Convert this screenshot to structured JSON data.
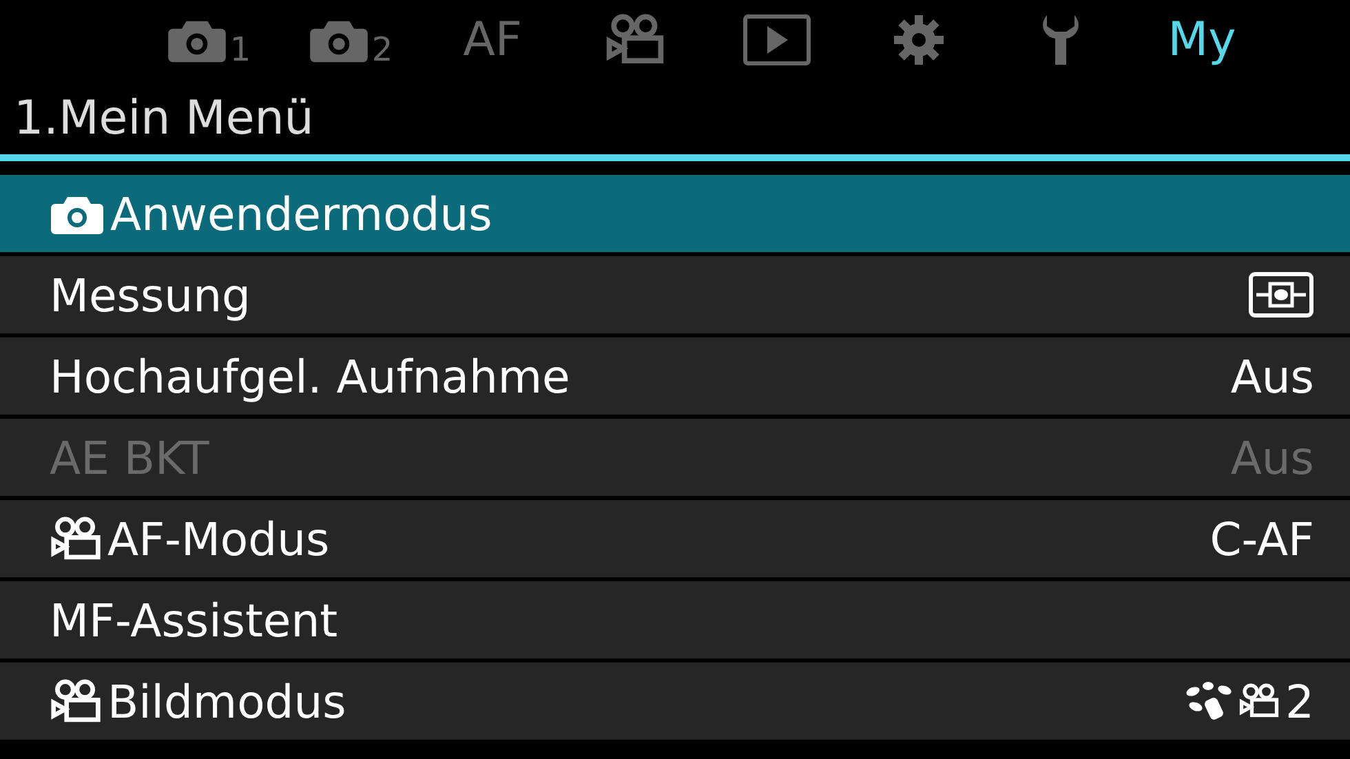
{
  "tabs": [
    {
      "kind": "camera",
      "sub": "1",
      "selected": false
    },
    {
      "kind": "camera",
      "sub": "2",
      "selected": false
    },
    {
      "kind": "text",
      "label": "AF",
      "selected": false
    },
    {
      "kind": "movie",
      "selected": false
    },
    {
      "kind": "play",
      "selected": false
    },
    {
      "kind": "gear",
      "selected": false
    },
    {
      "kind": "wrench",
      "selected": false
    },
    {
      "kind": "text",
      "label": "My",
      "selected": true
    }
  ],
  "title": "1.Mein Menü",
  "rows": [
    {
      "kind": "photo",
      "label": "Anwendermodus",
      "selected": true,
      "disabled": false
    },
    {
      "kind": "plain",
      "label": "Messung",
      "value": {
        "kind": "metering"
      },
      "selected": false,
      "disabled": false
    },
    {
      "kind": "plain",
      "label": "Hochaufgel. Aufnahme",
      "value": {
        "kind": "text",
        "text": "Aus"
      },
      "selected": false,
      "disabled": false
    },
    {
      "kind": "plain",
      "label": "AE BKT",
      "value": {
        "kind": "text",
        "text": "Aus"
      },
      "selected": false,
      "disabled": true
    },
    {
      "kind": "movie",
      "label": "AF-Modus",
      "value": {
        "kind": "text",
        "text": "C-AF"
      },
      "selected": false,
      "disabled": false
    },
    {
      "kind": "plain",
      "label": "MF-Assistent",
      "selected": false,
      "disabled": false
    },
    {
      "kind": "movie",
      "label": "Bildmodus",
      "value": {
        "kind": "picture-mode",
        "text": "2"
      },
      "selected": false,
      "disabled": false
    }
  ]
}
